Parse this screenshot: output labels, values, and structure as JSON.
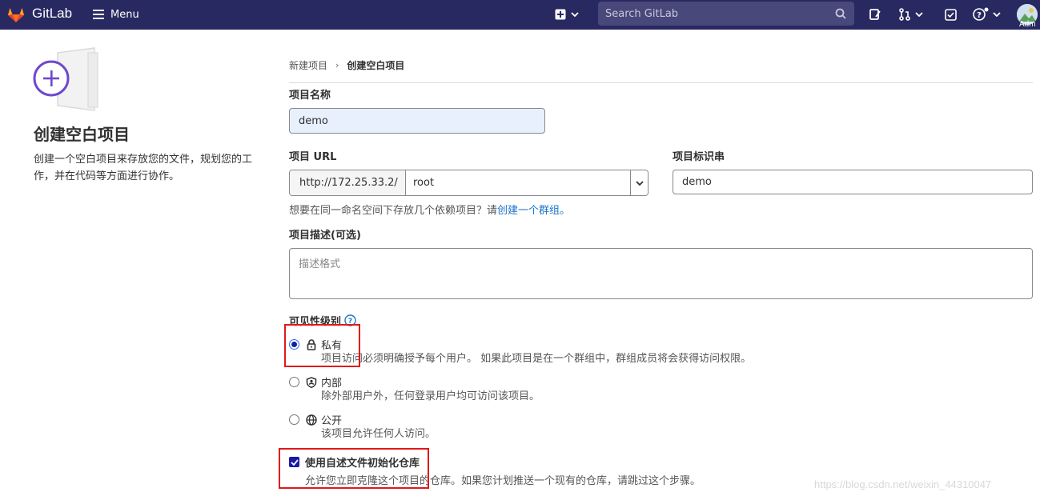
{
  "navbar": {
    "brand": "GitLab",
    "menu_label": "Menu",
    "search_placeholder": "Search GitLab",
    "avatar_label": "Adm",
    "bg_color": "#292961"
  },
  "left": {
    "title": "创建空白项目",
    "description": "创建一个空白项目来存放您的文件，规划您的工作，并在代码等方面进行协作。"
  },
  "breadcrumb": {
    "parent": "新建项目",
    "current": "创建空白项目"
  },
  "form": {
    "project_name_label": "项目名称",
    "project_name_value": "demo",
    "project_url_label": "项目 URL",
    "url_prefix": "http://172.25.33.2/",
    "url_namespace": "root",
    "slug_label": "项目标识串",
    "slug_value": "demo",
    "group_help_text": "想要在同一命名空间下存放几个依赖项目？请",
    "group_help_link": "创建一个群组。",
    "description_label": "项目描述(可选)",
    "description_placeholder": "描述格式",
    "visibility_label": "可见性级别",
    "visibility_options": [
      {
        "label": "私有",
        "help": "项目访问必须明确授予每个用户。 如果此项目是在一个群组中，群组成员将会获得访问权限。",
        "checked": true,
        "icon": "lock-icon"
      },
      {
        "label": "内部",
        "help": "除外部用户外，任何登录用户均可访问该项目。",
        "checked": false,
        "icon": "shield-icon"
      },
      {
        "label": "公开",
        "help": "该项目允许任何人访问。",
        "checked": false,
        "icon": "globe-icon"
      }
    ],
    "readme_label": "使用自述文件初始化仓库",
    "readme_help": "允许您立即克隆这个项目的仓库。如果您计划推送一个现有的仓库，请跳过这个步骤。",
    "readme_checked": true
  },
  "watermark": "https://blog.csdn.net/weixin_44310047",
  "colors": {
    "accent": "#1a1aa6",
    "link": "#1f75cb",
    "highlight": "#e0191b"
  }
}
